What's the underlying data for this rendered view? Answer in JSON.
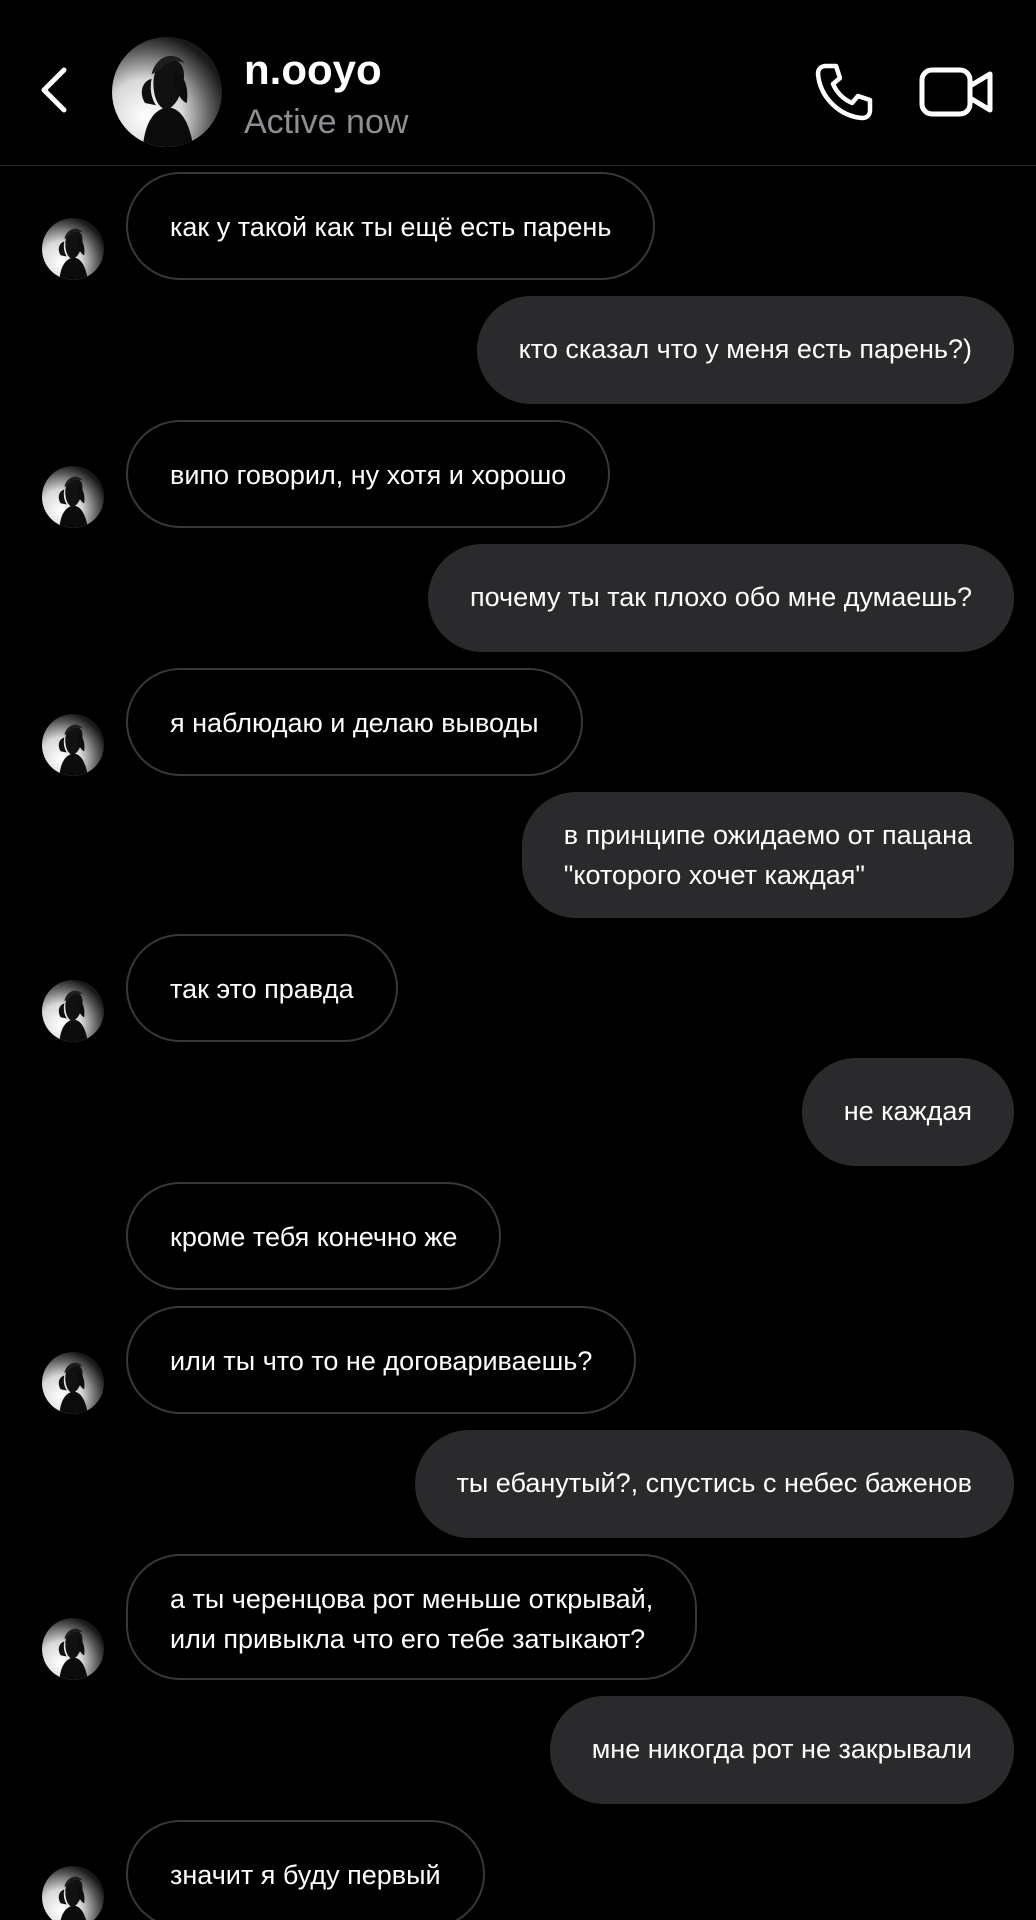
{
  "header": {
    "contact_name": "n.ooyo",
    "status": "Active now",
    "icons": {
      "back": "chevron-left-icon",
      "call": "phone-icon",
      "video": "video-camera-icon"
    }
  },
  "colors": {
    "background": "#000000",
    "outgoing_bubble": "#2a2a2d",
    "incoming_border": "#38383c",
    "status_text": "#8e8e93"
  },
  "messages": [
    {
      "direction": "in",
      "avatar": true,
      "lines": [
        "как у такой как ты ещё есть парень"
      ]
    },
    {
      "direction": "out",
      "lines": [
        "кто сказал что у меня есть парень?)"
      ]
    },
    {
      "direction": "in",
      "avatar": true,
      "lines": [
        "випо говорил, ну хотя и хорошо"
      ]
    },
    {
      "direction": "out",
      "lines": [
        "почему ты так плохо обо мне думаешь?"
      ]
    },
    {
      "direction": "in",
      "avatar": true,
      "lines": [
        "я наблюдаю и делаю выводы"
      ]
    },
    {
      "direction": "out",
      "lines": [
        "в принципе ожидаемо от пацана",
        "\"которого хочет каждая\""
      ]
    },
    {
      "direction": "in",
      "avatar": true,
      "lines": [
        "так это правда"
      ]
    },
    {
      "direction": "out",
      "lines": [
        "не каждая"
      ]
    },
    {
      "direction": "in",
      "avatar": false,
      "lines": [
        "кроме тебя конечно же"
      ]
    },
    {
      "direction": "in",
      "avatar": true,
      "lines": [
        "или ты что то не договариваешь?"
      ]
    },
    {
      "direction": "out",
      "lines": [
        "ты ебанутый?, спустись с небес баженов"
      ]
    },
    {
      "direction": "in",
      "avatar": true,
      "lines": [
        "а ты черенцова рот меньше открывай,",
        "или привыкла что его тебе затыкают?"
      ]
    },
    {
      "direction": "out",
      "lines": [
        "мне никогда рот не закрывали"
      ]
    },
    {
      "direction": "in",
      "avatar": true,
      "lines": [
        "значит я буду первый"
      ]
    }
  ]
}
